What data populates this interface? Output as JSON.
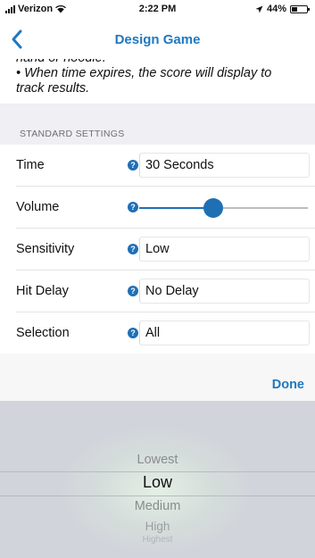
{
  "status_bar": {
    "carrier": "Verizon",
    "time": "2:22 PM",
    "battery": "44%",
    "battery_level": 0.44
  },
  "nav": {
    "title": "Design Game",
    "back_icon": "chevron-left-icon"
  },
  "description": {
    "line_partial": "hand or noodle.",
    "line_1": "• When time expires, the score will display to",
    "line_2": "track results."
  },
  "section": {
    "header": "STANDARD SETTINGS"
  },
  "settings": {
    "time": {
      "label": "Time",
      "value": "30 Seconds"
    },
    "volume": {
      "label": "Volume",
      "level": 0.44
    },
    "sensitivity": {
      "label": "Sensitivity",
      "value": "Low"
    },
    "hit_delay": {
      "label": "Hit Delay",
      "value": "No Delay"
    },
    "selection": {
      "label": "Selection",
      "value": "All"
    }
  },
  "help_icon_glyph": "?",
  "picker": {
    "done_label": "Done",
    "options": [
      "Lowest",
      "Low",
      "Medium",
      "High",
      "Highest"
    ],
    "selected": "Low"
  },
  "colors": {
    "accent": "#1f78c1",
    "control": "#1f6fb5",
    "group_background": "#efeff4"
  }
}
